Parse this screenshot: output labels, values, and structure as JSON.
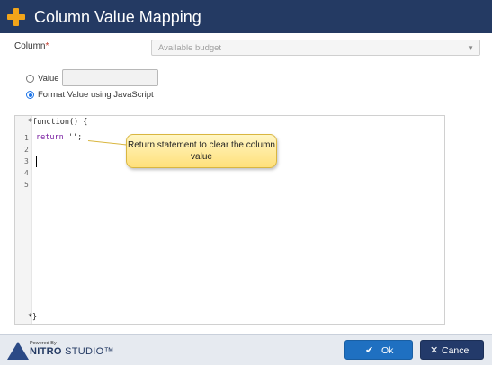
{
  "titlebar": {
    "title": "Column Value Mapping",
    "icon": "plus-icon",
    "accent": "#f2a51a",
    "bg": "#243a63"
  },
  "column": {
    "label": "Column",
    "required_mark": "*",
    "selected": "Available budget"
  },
  "options": {
    "value_label": "Value",
    "value_input": "",
    "js_label": "Format Value using JavaScript",
    "selected": "js"
  },
  "editor": {
    "header": "function() {",
    "lines": [
      {
        "num": "1",
        "keyword": "return",
        "rest": " '';"
      },
      {
        "num": "2",
        "keyword": "",
        "rest": ""
      },
      {
        "num": "3",
        "keyword": "",
        "rest": ""
      },
      {
        "num": "4",
        "keyword": "",
        "rest": ""
      },
      {
        "num": "5",
        "keyword": "",
        "rest": ""
      }
    ],
    "footer": "}",
    "marker": "*"
  },
  "callout": {
    "text": "Return statement to clear the column value"
  },
  "footer": {
    "powered_by": "Powered By",
    "brand": "NITRO",
    "brand2": "STUDIO™",
    "ok_label": "Ok",
    "cancel_label": "Cancel",
    "ok_color": "#1f70c1",
    "cancel_color": "#233a6a"
  }
}
